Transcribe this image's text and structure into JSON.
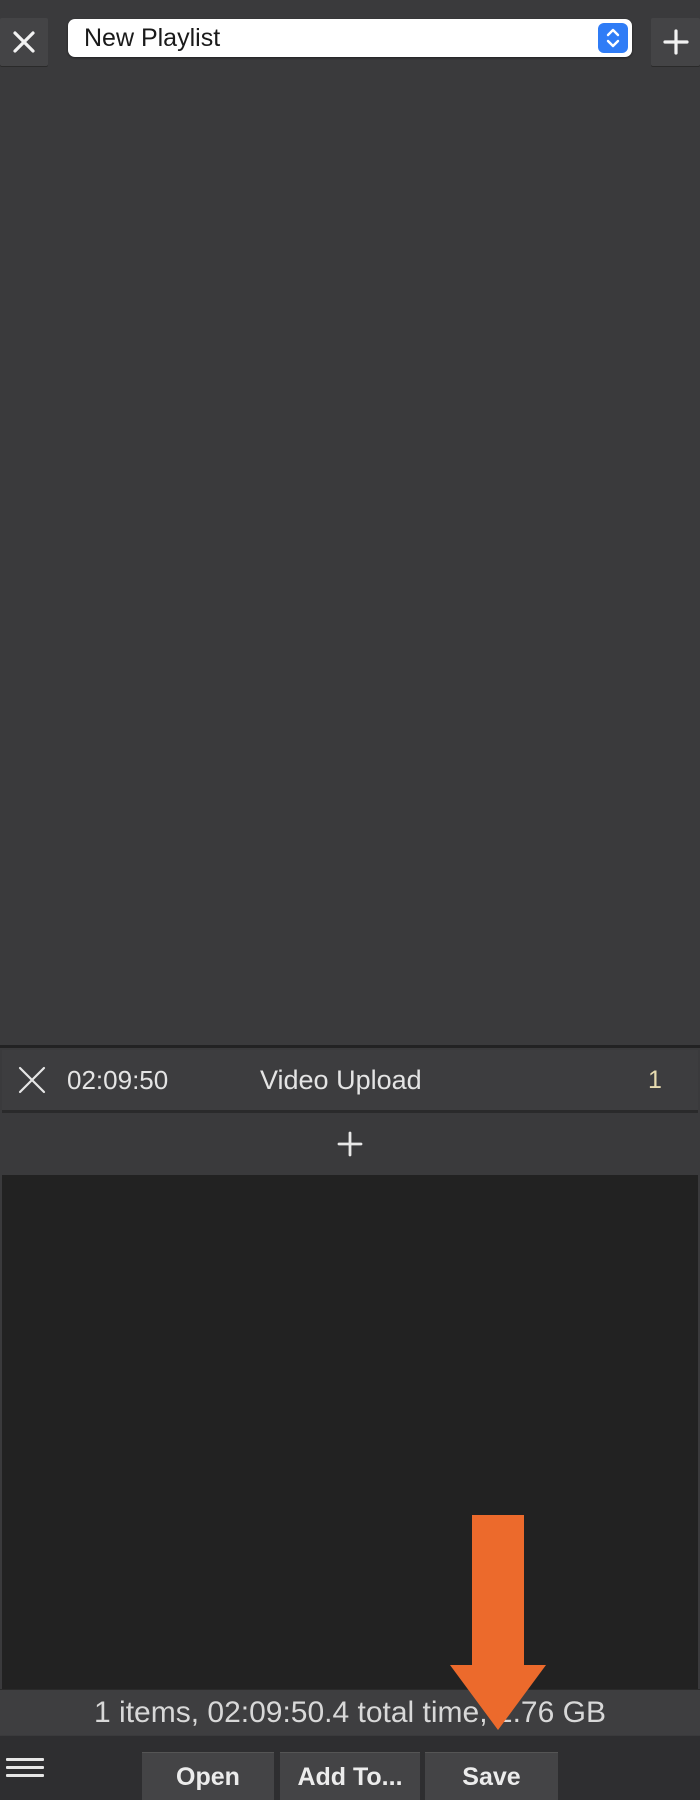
{
  "toolbar_top": {
    "close_icon": "close-x-icon",
    "playlist_select": {
      "value": "New Playlist",
      "stepper_icon": "updown-stepper-icon",
      "accent": "#2f7cf6"
    },
    "add_icon": "plus-icon"
  },
  "playlist": {
    "items": [
      {
        "remove_icon": "close-x-icon",
        "duration": "02:09:50",
        "title": "Video Upload",
        "count": "1"
      }
    ],
    "add_row_icon": "plus-icon"
  },
  "status": {
    "summary": "1 items, 02:09:50.4 total time, 2.76 GB"
  },
  "bottom_bar": {
    "menu_icon": "hamburger-menu-icon",
    "open_label": "Open",
    "add_to_label": "Add To...",
    "save_label": "Save"
  },
  "annotation": {
    "arrow_color": "#ec6a2c",
    "points_to": "save-button"
  }
}
